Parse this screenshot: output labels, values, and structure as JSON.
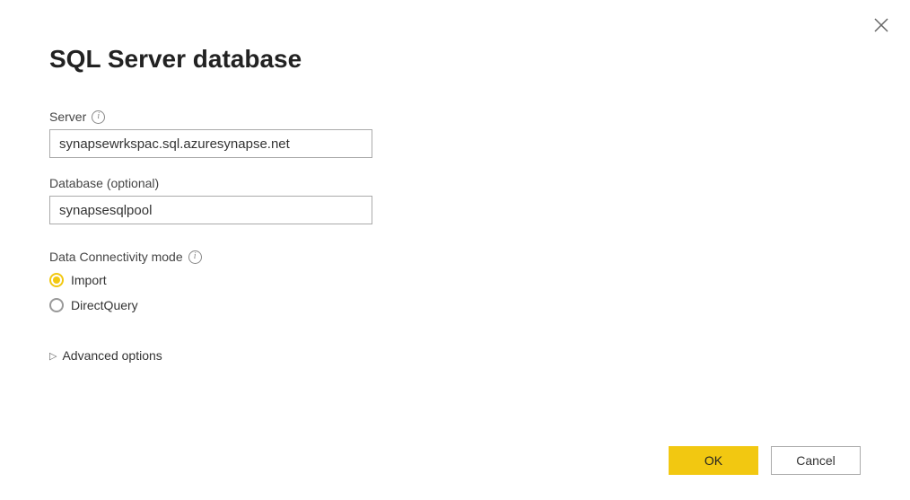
{
  "dialog": {
    "title": "SQL Server database"
  },
  "fields": {
    "server": {
      "label": "Server",
      "value": "synapsewrkspac.sql.azuresynapse.net"
    },
    "database": {
      "label": "Database (optional)",
      "value": "synapsesqlpool"
    }
  },
  "connectivity": {
    "label": "Data Connectivity mode",
    "options": {
      "import": "Import",
      "directquery": "DirectQuery"
    },
    "selected": "import"
  },
  "advanced": {
    "label": "Advanced options"
  },
  "buttons": {
    "ok": "OK",
    "cancel": "Cancel"
  }
}
